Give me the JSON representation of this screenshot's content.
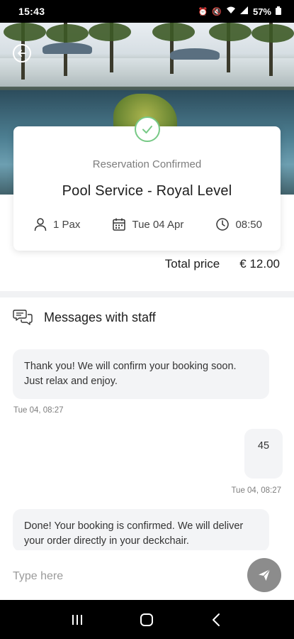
{
  "status_bar": {
    "time": "15:43",
    "battery": "57%",
    "icons": [
      "alarm-icon",
      "mute-icon",
      "wifi-icon",
      "signal-icon",
      "battery-icon"
    ]
  },
  "header": {
    "back_icon": "back-arrow-icon"
  },
  "reservation": {
    "status": "Reservation Confirmed",
    "title": "Pool Service - Royal Level",
    "pax": "1 Pax",
    "date": "Tue 04 Apr",
    "time": "08:50",
    "icons": {
      "status": "check-icon",
      "pax": "person-icon",
      "date": "calendar-icon",
      "time": "clock-icon"
    }
  },
  "total": {
    "label": "Total price",
    "value": "€ 12.00"
  },
  "messages": {
    "header": "Messages with staff",
    "header_icon": "chat-bubbles-icon",
    "items": [
      {
        "side": "left",
        "text": "Thank you! We will confirm your booking soon. Just relax and enjoy.",
        "timestamp": "Tue 04, 08:27"
      },
      {
        "side": "right",
        "text": "45",
        "timestamp": "Tue 04, 08:27"
      },
      {
        "side": "left",
        "text": "Done! Your booking is confirmed. We will deliver your order directly in your deckchair.",
        "timestamp": ""
      }
    ]
  },
  "composer": {
    "placeholder": "Type here",
    "value": "",
    "send_icon": "send-icon"
  },
  "nav_bar": {
    "items": [
      "recent-apps-icon",
      "home-icon",
      "back-icon"
    ]
  },
  "colors": {
    "accent_green": "#77c986",
    "bubble_bg": "#f3f4f6",
    "send_button": "#8c8c8c"
  }
}
